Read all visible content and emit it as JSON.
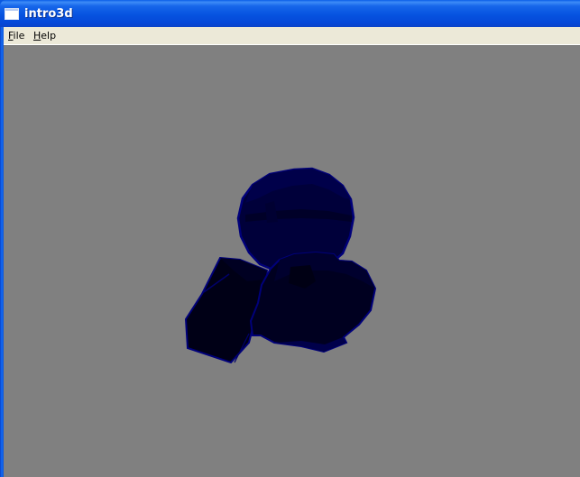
{
  "window": {
    "title": "intro3d"
  },
  "menubar": {
    "items": [
      {
        "id": "file",
        "accel": "F",
        "rest": "ile"
      },
      {
        "id": "help",
        "accel": "H",
        "rest": "elp"
      }
    ]
  },
  "scene": {
    "background_color": "#808080",
    "object_color": "#00007a",
    "shadow_color": "#00001e"
  }
}
